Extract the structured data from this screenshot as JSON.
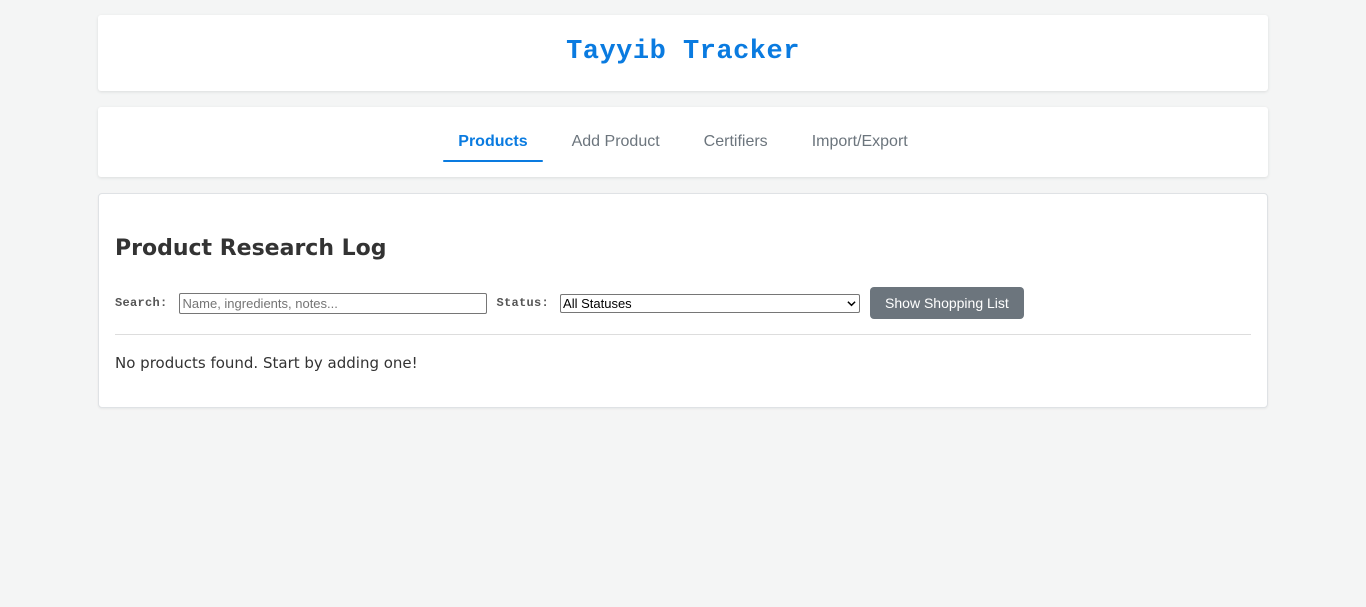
{
  "header": {
    "title": "Tayyib Tracker"
  },
  "nav": {
    "tabs": [
      {
        "label": "Products",
        "active": true
      },
      {
        "label": "Add Product",
        "active": false
      },
      {
        "label": "Certifiers",
        "active": false
      },
      {
        "label": "Import/Export",
        "active": false
      }
    ]
  },
  "main": {
    "title": "Product Research Log",
    "search": {
      "label": "Search:",
      "placeholder": "Name, ingredients, notes...",
      "value": ""
    },
    "status": {
      "label": "Status:",
      "selected": "All Statuses"
    },
    "shopping_button": "Show Shopping List",
    "empty_message": "No products found. Start by adding one!"
  },
  "colors": {
    "accent": "#0a7be0",
    "secondary_button": "#6c757d",
    "background": "#f4f5f5"
  },
  "icons": {
    "select_arrow": "chevron-down-icon"
  }
}
